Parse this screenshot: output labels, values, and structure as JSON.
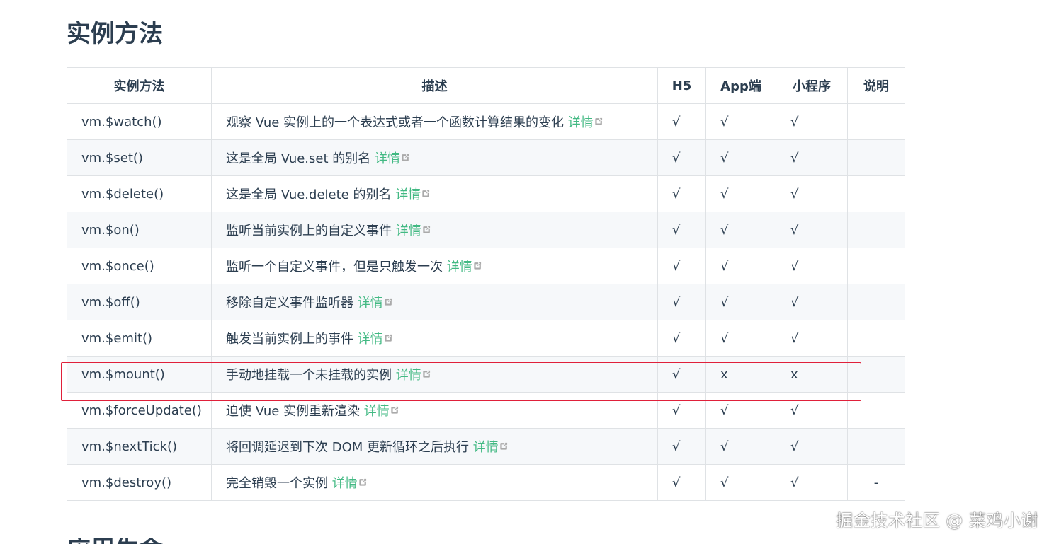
{
  "section_title": "实例方法",
  "table": {
    "headers": {
      "method": "实例方法",
      "desc": "描述",
      "h5": "H5",
      "app": "App端",
      "miniprogram": "小程序",
      "note": "说明"
    },
    "link_label": "详情",
    "rows": [
      {
        "method": "vm.$watch()",
        "desc": "观察 Vue 实例上的一个表达式或者一个函数计算结果的变化",
        "h5": "√",
        "app": "√",
        "miniprogram": "√",
        "note": ""
      },
      {
        "method": "vm.$set()",
        "desc": "这是全局 Vue.set 的别名",
        "h5": "√",
        "app": "√",
        "miniprogram": "√",
        "note": ""
      },
      {
        "method": "vm.$delete()",
        "desc": "这是全局 Vue.delete 的别名",
        "h5": "√",
        "app": "√",
        "miniprogram": "√",
        "note": ""
      },
      {
        "method": "vm.$on()",
        "desc": "监听当前实例上的自定义事件",
        "h5": "√",
        "app": "√",
        "miniprogram": "√",
        "note": ""
      },
      {
        "method": "vm.$once()",
        "desc": "监听一个自定义事件，但是只触发一次",
        "h5": "√",
        "app": "√",
        "miniprogram": "√",
        "note": ""
      },
      {
        "method": "vm.$off()",
        "desc": "移除自定义事件监听器",
        "h5": "√",
        "app": "√",
        "miniprogram": "√",
        "note": ""
      },
      {
        "method": "vm.$emit()",
        "desc": "触发当前实例上的事件",
        "h5": "√",
        "app": "√",
        "miniprogram": "√",
        "note": ""
      },
      {
        "method": "vm.$mount()",
        "desc": "手动地挂载一个未挂载的实例",
        "h5": "√",
        "app": "x",
        "miniprogram": "x",
        "note": ""
      },
      {
        "method": "vm.$forceUpdate()",
        "desc": "迫使 Vue 实例重新渲染",
        "h5": "√",
        "app": "√",
        "miniprogram": "√",
        "note": ""
      },
      {
        "method": "vm.$nextTick()",
        "desc": "将回调延迟到下次 DOM 更新循环之后执行",
        "h5": "√",
        "app": "√",
        "miniprogram": "√",
        "note": ""
      },
      {
        "method": "vm.$destroy()",
        "desc": "完全销毁一个实例",
        "h5": "√",
        "app": "√",
        "miniprogram": "√",
        "note": "-"
      }
    ]
  },
  "icons": {
    "external_link": "external-link-icon"
  },
  "colors": {
    "link": "#42b983",
    "text": "#2c3e50",
    "border": "#dfe2e5",
    "stripe": "#f6f8fa",
    "highlight": "#e0203a"
  },
  "next_section_title": "应用生命",
  "watermark": "掘金技术社区 @ 菜鸡小谢"
}
